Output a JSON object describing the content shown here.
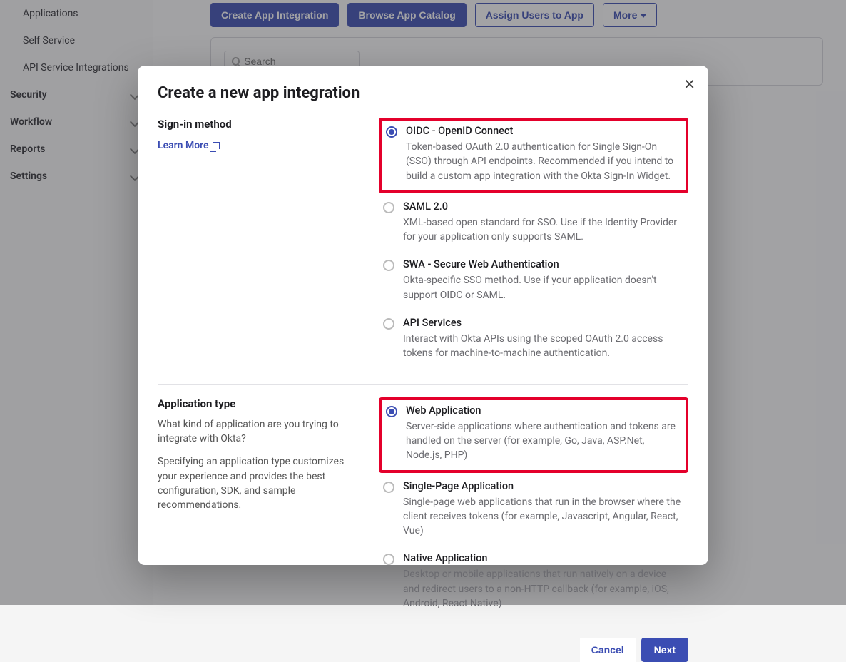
{
  "sidebar": {
    "items": [
      {
        "label": "Applications"
      },
      {
        "label": "Self Service"
      },
      {
        "label": "API Service Integrations"
      }
    ],
    "sections": [
      {
        "label": "Security"
      },
      {
        "label": "Workflow"
      },
      {
        "label": "Reports"
      },
      {
        "label": "Settings"
      }
    ]
  },
  "toolbar": {
    "create": "Create App Integration",
    "browse": "Browse App Catalog",
    "assign": "Assign Users to App",
    "more": "More"
  },
  "search": {
    "placeholder": "Search"
  },
  "modal": {
    "title": "Create a new app integration",
    "signin": {
      "heading": "Sign-in method",
      "learn_more": "Learn More",
      "options": [
        {
          "title": "OIDC - OpenID Connect",
          "desc": "Token-based OAuth 2.0 authentication for Single Sign-On (SSO) through API endpoints. Recommended if you intend to build a custom app integration with the Okta Sign-In Widget.",
          "selected": true,
          "highlighted": true
        },
        {
          "title": "SAML 2.0",
          "desc": "XML-based open standard for SSO. Use if the Identity Provider for your application only supports SAML.",
          "selected": false,
          "highlighted": false
        },
        {
          "title": "SWA - Secure Web Authentication",
          "desc": "Okta-specific SSO method. Use if your application doesn't support OIDC or SAML.",
          "selected": false,
          "highlighted": false
        },
        {
          "title": "API Services",
          "desc": "Interact with Okta APIs using the scoped OAuth 2.0 access tokens for machine-to-machine authentication.",
          "selected": false,
          "highlighted": false
        }
      ]
    },
    "apptype": {
      "heading": "Application type",
      "p1": "What kind of application are you trying to integrate with Okta?",
      "p2": "Specifying an application type customizes your experience and provides the best configuration, SDK, and sample recommendations.",
      "options": [
        {
          "title": "Web Application",
          "desc": "Server-side applications where authentication and tokens are handled on the server (for example, Go, Java, ASP.Net, Node.js, PHP)",
          "selected": true,
          "highlighted": true
        },
        {
          "title": "Single-Page Application",
          "desc": "Single-page web applications that run in the browser where the client receives tokens (for example, Javascript, Angular, React, Vue)",
          "selected": false,
          "highlighted": false
        },
        {
          "title": "Native Application",
          "desc": "Desktop or mobile applications that run natively on a device and redirect users to a non-HTTP callback (for example, iOS, Android, React Native)",
          "selected": false,
          "highlighted": false
        }
      ]
    },
    "footer": {
      "cancel": "Cancel",
      "next": "Next"
    }
  }
}
